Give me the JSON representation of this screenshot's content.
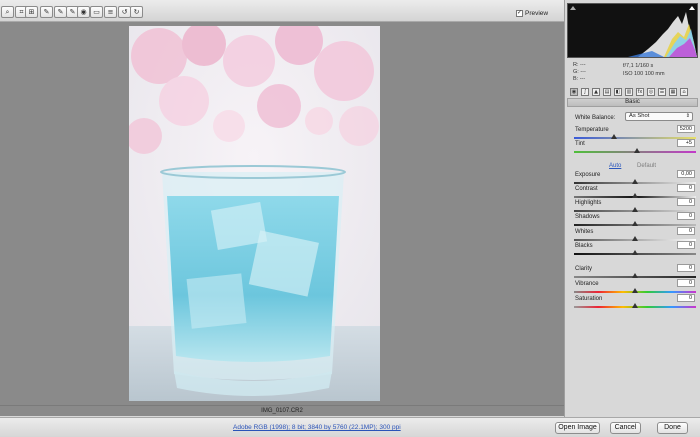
{
  "toolbar": {
    "tools": [
      {
        "icon": "zoom-icon",
        "glyph": "⌕"
      },
      {
        "icon": "crop-icon",
        "glyph": "⌗"
      },
      {
        "icon": "straighten-icon",
        "glyph": "⊞"
      },
      {
        "icon": "white-balance-icon",
        "glyph": "✎"
      },
      {
        "icon": "color-sampler-icon",
        "glyph": "✎"
      },
      {
        "icon": "targeted-adjust-icon",
        "glyph": "✎"
      },
      {
        "icon": "spot-removal-icon",
        "glyph": "◉"
      },
      {
        "icon": "red-eye-icon",
        "glyph": "▭"
      },
      {
        "icon": "preferences-icon",
        "glyph": "≡"
      },
      {
        "icon": "rotate-left-icon",
        "glyph": "↺"
      },
      {
        "icon": "rotate-right-icon",
        "glyph": "↻"
      }
    ],
    "preview_label": "Preview",
    "preview_checked": true
  },
  "canvas": {
    "filename": "IMG_0107.CR2"
  },
  "bottom": {
    "workflow_link": "Adobe RGB (1998); 8 bit; 3840 by 5760 (22.1MP); 300 ppi",
    "open_label": "Open Image",
    "cancel_label": "Cancel",
    "done_label": "Done"
  },
  "panel": {
    "readout": {
      "r": "R:  ---",
      "g": "G:  ---",
      "b": "B:  ---",
      "aperture_shutter": "f/7,1    1/160 s",
      "iso_focal": "ISO 100    100 mm"
    },
    "section_title": "Basic",
    "white_balance_label": "White Balance:",
    "white_balance_value": "As Shot",
    "auto_label": "Auto",
    "default_label": "Default",
    "sliders": [
      {
        "name": "temperature",
        "label": "Temperature",
        "value": "5200",
        "fraction": 0.33,
        "gradient": "linear-gradient(90deg,#3a5ad8,#e8e06a)"
      },
      {
        "name": "tint",
        "label": "Tint",
        "value": "+5",
        "fraction": 0.52,
        "gradient": "linear-gradient(90deg,#4fbf3a,#c23ac9)"
      },
      {
        "name": "exposure",
        "label": "Exposure",
        "value": "0,00",
        "fraction": 0.5,
        "gradient": "linear-gradient(90deg,#333,#eee)"
      },
      {
        "name": "contrast",
        "label": "Contrast",
        "value": "0",
        "fraction": 0.5,
        "gradient": "linear-gradient(90deg,#777,#111 50%,#eee)"
      },
      {
        "name": "highlights",
        "label": "Highlights",
        "value": "0",
        "fraction": 0.5,
        "gradient": "linear-gradient(90deg,#444,#ddd)"
      },
      {
        "name": "shadows",
        "label": "Shadows",
        "value": "0",
        "fraction": 0.5,
        "gradient": "linear-gradient(90deg,#222,#bbb)"
      },
      {
        "name": "whites",
        "label": "Whites",
        "value": "0",
        "fraction": 0.5,
        "gradient": "linear-gradient(90deg,#555,#fff)"
      },
      {
        "name": "blacks",
        "label": "Blacks",
        "value": "0",
        "fraction": 0.5,
        "gradient": "linear-gradient(90deg,#111,#888)"
      },
      {
        "name": "clarity",
        "label": "Clarity",
        "value": "0",
        "fraction": 0.5,
        "gradient": "linear-gradient(90deg,#888,#222)"
      },
      {
        "name": "vibrance",
        "label": "Vibrance",
        "value": "0",
        "fraction": 0.5,
        "gradient": "linear-gradient(90deg,#888,#e23,#fb0,#3c3,#39f,#c3c)"
      },
      {
        "name": "saturation",
        "label": "Saturation",
        "value": "0",
        "fraction": 0.5,
        "gradient": "linear-gradient(90deg,#999,#e23,#fb0,#3c3,#39f,#c3c)"
      }
    ]
  }
}
